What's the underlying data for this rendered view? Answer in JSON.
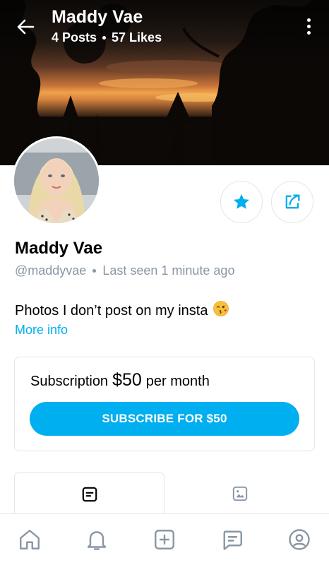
{
  "header": {
    "title": "Maddy Vae",
    "posts": "4 Posts",
    "likes": "57 Likes"
  },
  "profile": {
    "name": "Maddy Vae",
    "handle": "@maddyvae",
    "last_seen": "Last seen 1 minute ago",
    "bio": "Photos I don’t post on my insta",
    "bio_emoji": "😘",
    "more_info": "More info"
  },
  "subscription": {
    "prefix": "Subscription",
    "price": "$50",
    "suffix": "per month",
    "button_label": "SUBSCRIBE FOR $50"
  },
  "tabs": [
    {
      "icon": "posts-icon",
      "active": true
    },
    {
      "icon": "media-icon",
      "active": false
    }
  ],
  "bottom_nav": [
    "home-icon",
    "notifications-icon",
    "add-post-icon",
    "messages-icon",
    "profile-icon"
  ],
  "colors": {
    "accent": "#00aff0",
    "border": "#e3e6ea",
    "muted_text": "#8a96a3"
  }
}
